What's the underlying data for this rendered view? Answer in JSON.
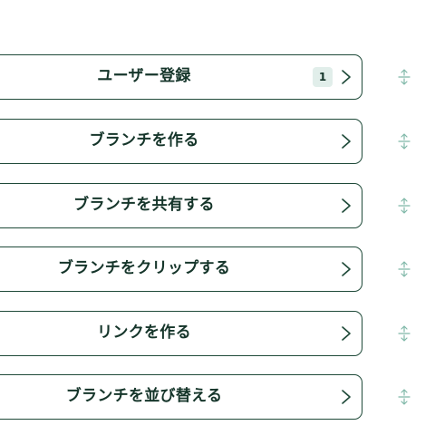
{
  "items": [
    {
      "label": "ユーザー登録",
      "badge": "1"
    },
    {
      "label": "ブランチを作る"
    },
    {
      "label": "ブランチを共有する"
    },
    {
      "label": "ブランチをクリップする"
    },
    {
      "label": "リンクを作る"
    },
    {
      "label": "ブランチを並び替える"
    }
  ],
  "icons": {
    "chevron": "chevron-right-icon",
    "handle": "drag-handle-icon"
  },
  "colors": {
    "border": "#1f4a39",
    "text": "#15352a",
    "badge_bg": "#e1eeea",
    "handle": "#7fb8a8"
  }
}
